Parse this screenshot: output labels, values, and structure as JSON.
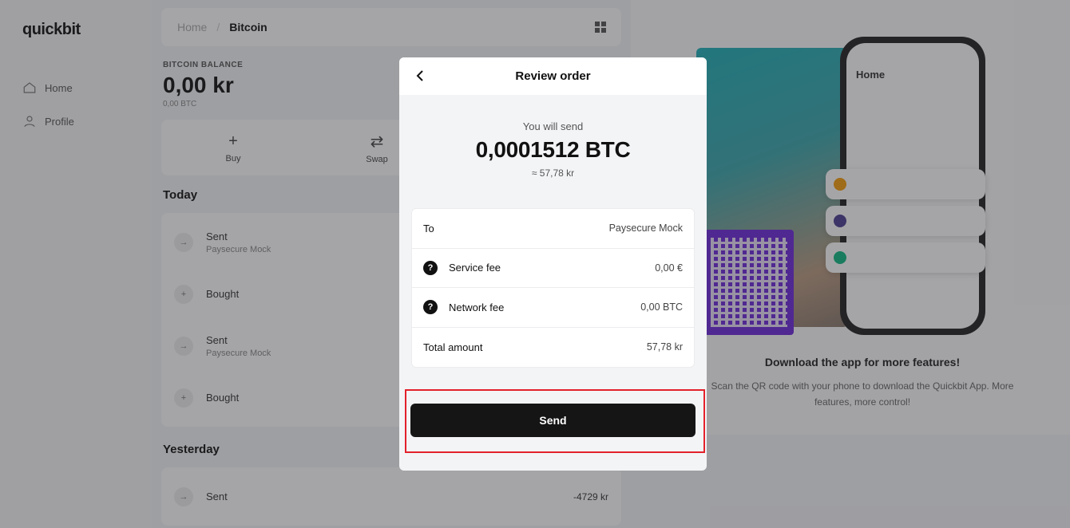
{
  "background": {
    "logo": "quickbit",
    "nav": [
      {
        "label": "Home",
        "icon": "home-icon"
      },
      {
        "label": "Profile",
        "icon": "user-icon"
      }
    ],
    "breadcrumb": {
      "home": "Home",
      "current": "Bitcoin"
    },
    "balance": {
      "label": "BITCOIN BALANCE",
      "amount": "0,00 kr",
      "sub": "0,00 BTC"
    },
    "actions": [
      {
        "label": "Buy",
        "symbol": "+"
      },
      {
        "label": "Swap",
        "symbol": "⇄"
      }
    ],
    "today_heading": "Today",
    "today_tx": [
      {
        "title": "Sent",
        "subtitle": "Paysecure Mock",
        "icon": "→"
      },
      {
        "title": "Bought",
        "subtitle": "",
        "icon": "+"
      },
      {
        "title": "Sent",
        "subtitle": "Paysecure Mock",
        "icon": "→"
      },
      {
        "title": "Bought",
        "subtitle": "",
        "icon": "+"
      }
    ],
    "yesterday_heading": "Yesterday",
    "yesterday_tx": [
      {
        "title": "Sent",
        "subtitle": "",
        "amount": "-4729 kr",
        "icon": "→"
      }
    ],
    "promo": {
      "phone_title": "Home",
      "title": "Download the app for more features!",
      "text": "Scan the QR code with your phone to download the Quickbit App. More features, more control!"
    }
  },
  "modal": {
    "title": "Review order",
    "you_will_send": "You will send",
    "amount_btc": "0,0001512 BTC",
    "amount_fiat": "≈ 57,78 kr",
    "rows": [
      {
        "label": "To",
        "value": "Paysecure Mock"
      },
      {
        "label": "Service fee",
        "value": "0,00 €"
      },
      {
        "label": "Network fee",
        "value": "0,00 BTC"
      },
      {
        "label": "Total amount",
        "value": "57,78 kr"
      }
    ],
    "send_label": "Send"
  },
  "colors": {
    "highlight": "#e3212b",
    "button": "#151515",
    "qr": "#6d28d9"
  }
}
